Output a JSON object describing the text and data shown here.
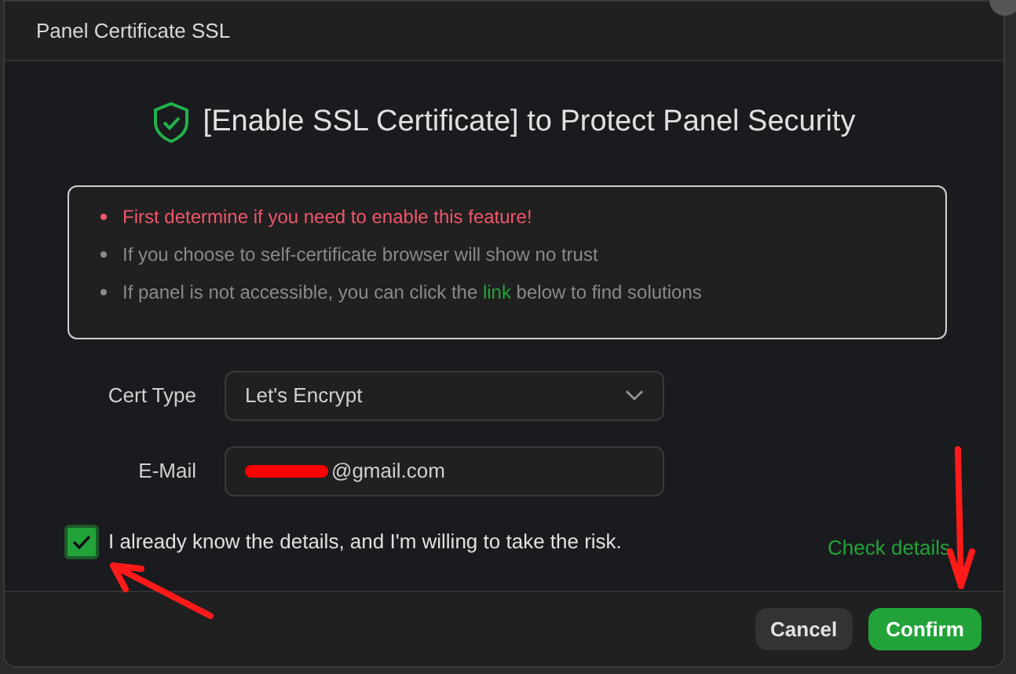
{
  "dialog": {
    "title": "Panel Certificate SSL"
  },
  "heading": "[Enable SSL Certificate] to Protect Panel Security",
  "notices": [
    {
      "text": "First determine if you need to enable this feature!",
      "kind": "warning"
    },
    {
      "text": "If you choose to self-certificate browser will show no trust",
      "kind": "info"
    },
    {
      "text": "If panel is not accessible, you can click the **link** below to find solutions",
      "kind": "info"
    }
  ],
  "form": {
    "cert_type": {
      "label": "Cert Type",
      "value": "Let's Encrypt"
    },
    "email": {
      "label": "E-Mail",
      "value": "@gmail.com"
    }
  },
  "agreement": {
    "label": "I already know the details, and I'm willing to take the risk.",
    "checked": true
  },
  "check_details_link": "Check details",
  "buttons": [
    {
      "label": "Cancel",
      "kind": "secondary"
    },
    {
      "label": "Confirm",
      "kind": "primary"
    }
  ]
}
